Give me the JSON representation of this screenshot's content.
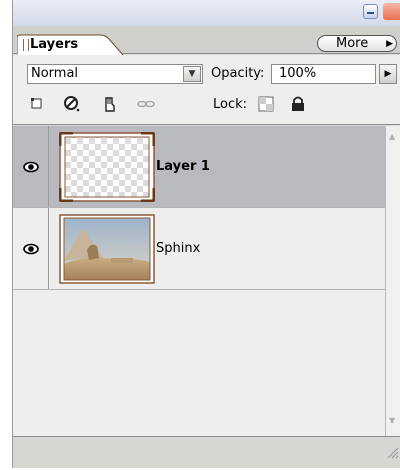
{
  "panel": {
    "tab_label": "Layers",
    "more_label": "More",
    "blend_mode": "Normal",
    "opacity_label": "Opacity:",
    "opacity_value": "100%",
    "lock_label": "Lock:",
    "tools": [
      "layer-link-icon",
      "layer-style-icon",
      "brush-icon",
      "chain-link-icon"
    ],
    "lock_icons": [
      "lock-transparent-icon",
      "lock-all-icon"
    ]
  },
  "layers": [
    {
      "name": "Layer 1",
      "selected": true,
      "visible": true,
      "thumbnail": "transparent"
    },
    {
      "name": "Sphinx",
      "selected": false,
      "visible": true,
      "thumbnail": "sphinx-photo"
    }
  ],
  "colors": {
    "selected_row": "#b9bac0",
    "panel_bg": "#eeeeec",
    "thumb_border": "#8a5a3a"
  }
}
